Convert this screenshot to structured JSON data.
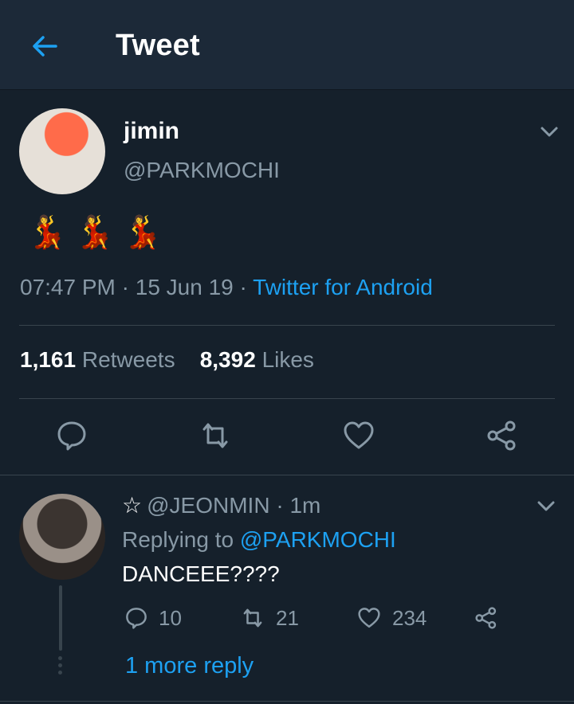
{
  "header": {
    "title": "Tweet",
    "back_icon": "arrow-left-icon"
  },
  "tweet": {
    "display_name": "jimin",
    "handle": "@PARKMOCHI",
    "content": "💃💃💃",
    "time": "07:47 PM",
    "date": "15 Jun 19",
    "source": "Twitter for Android",
    "retweets_count": "1,161",
    "retweets_label": "Retweets",
    "likes_count": "8,392",
    "likes_label": "Likes",
    "actions": [
      "reply-icon",
      "retweet-icon",
      "like-icon",
      "share-icon"
    ]
  },
  "reply": {
    "handle": "@JEONMIN",
    "age": "1m",
    "replying_to_label": "Replying to",
    "replying_to_handle": "@PARKMOCHI",
    "text": "DANCEEE????",
    "reply_count": "10",
    "retweet_count": "21",
    "like_count": "234",
    "more_replies": "1 more reply"
  },
  "colors": {
    "background": "#15202b",
    "header": "#1c2938",
    "accent": "#1da1f2",
    "muted": "#8899a6",
    "divider": "#38444d"
  }
}
